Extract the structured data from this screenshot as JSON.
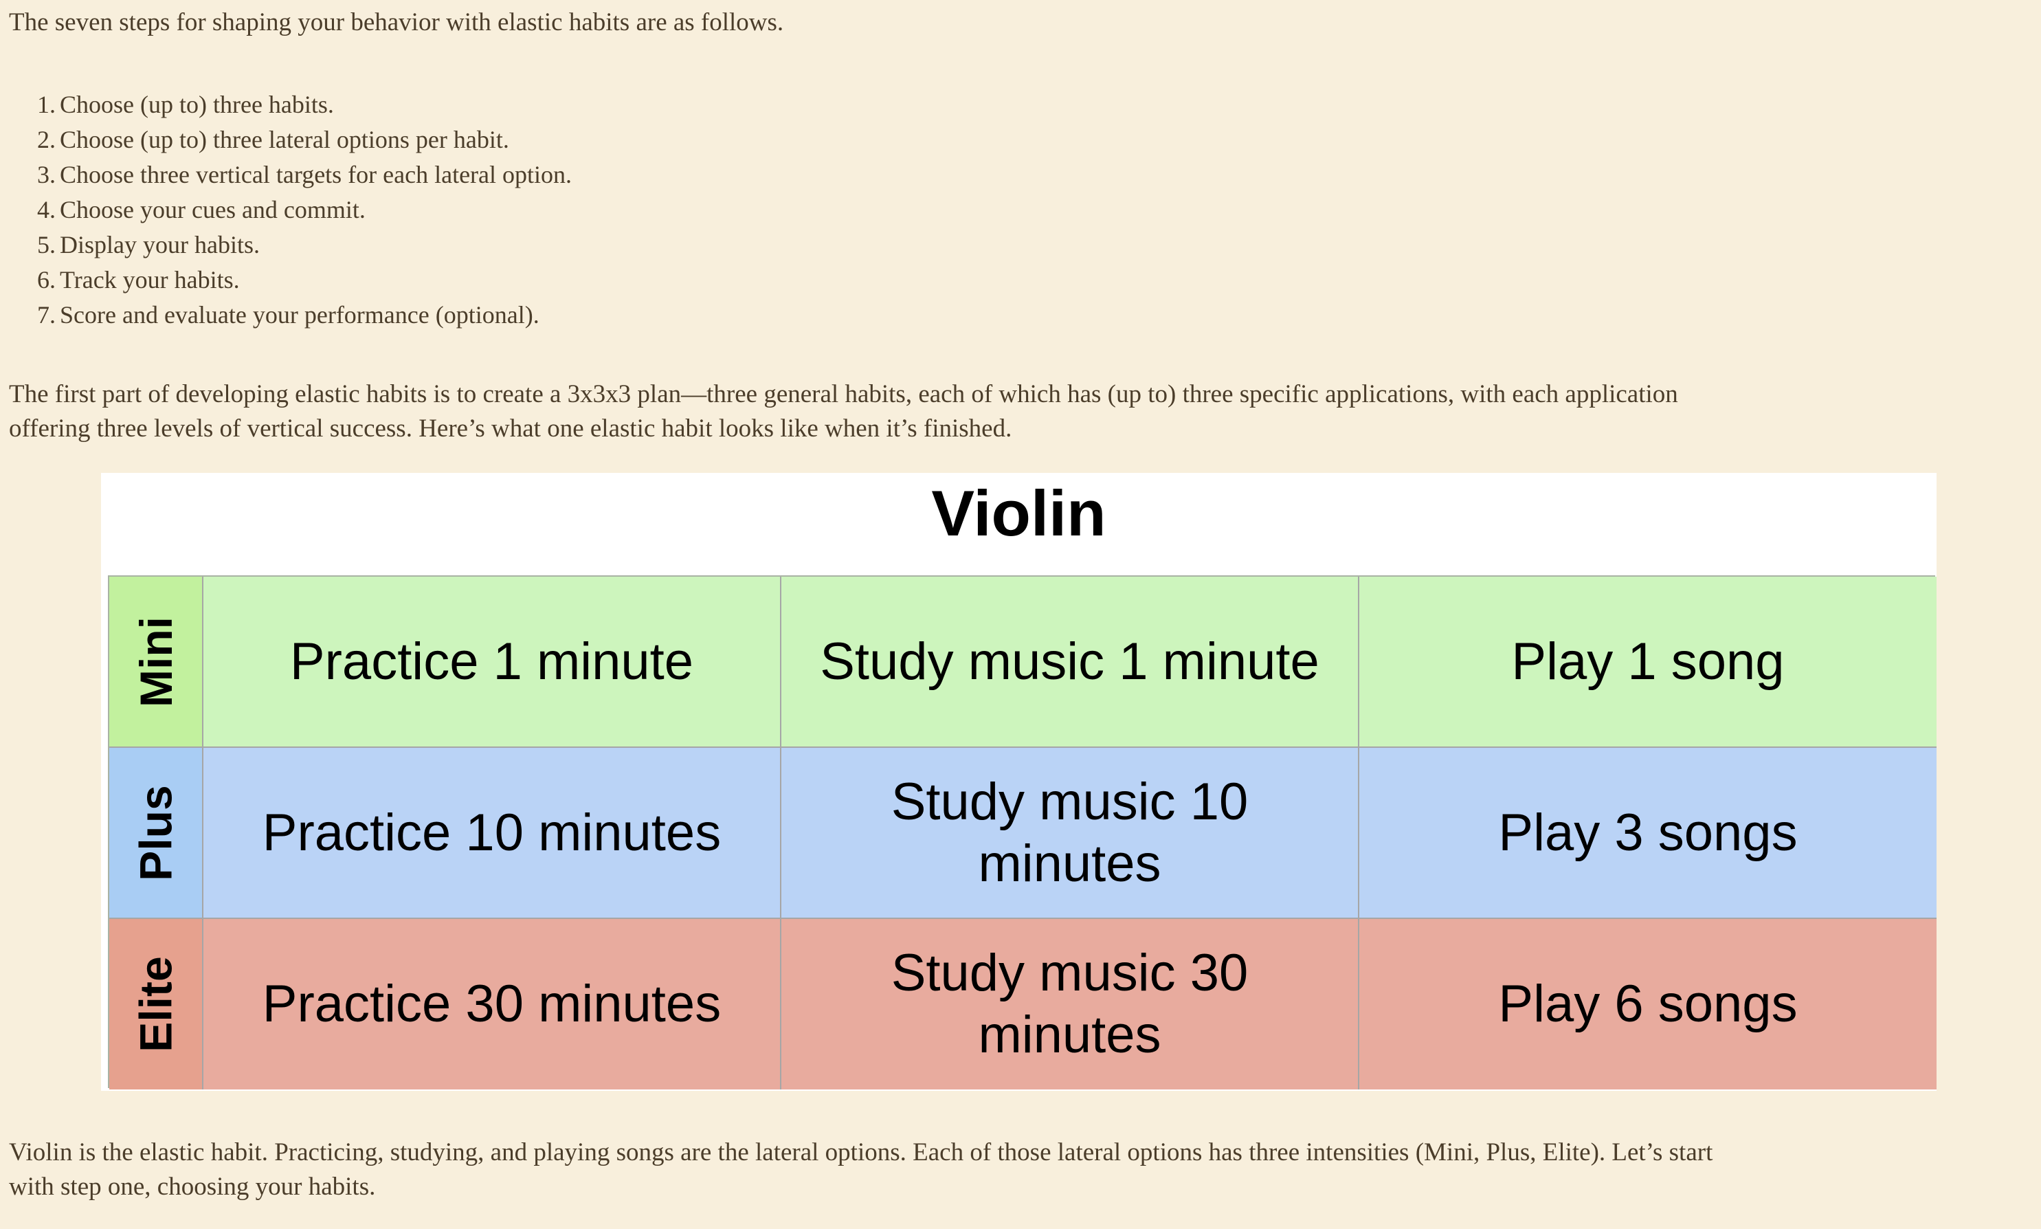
{
  "article": {
    "intro": "The seven steps for shaping your behavior with elastic habits are as follows.",
    "steps": [
      {
        "number": "1.",
        "text": "Choose (up to) three habits."
      },
      {
        "number": "2.",
        "text": "Choose (up to) three lateral options per habit."
      },
      {
        "number": "3.",
        "text": "Choose three vertical targets for each lateral option."
      },
      {
        "number": "4.",
        "text": "Choose your cues and commit."
      },
      {
        "number": "5.",
        "text": "Display your habits."
      },
      {
        "number": "6.",
        "text": "Track your habits."
      },
      {
        "number": "7.",
        "text": "Score and evaluate your performance (optional)."
      }
    ],
    "plan_paragraph": [
      "The first part of developing elastic habits is to create a 3x3x3 plan—three general habits, each of which has (up to) three specific applications, with each application",
      "offering three levels of vertical success. Here’s what one elastic habit looks like when it’s finished."
    ],
    "outro_paragraph": [
      "Violin is the elastic habit. Practicing, studying, and playing songs are the lateral options. Each of those lateral options has three intensities (Mini, Plus, Elite). Let’s start",
      "with step one, choosing your habits."
    ]
  },
  "habit_figure": {
    "title": "Violin",
    "levels": [
      {
        "label": "Mini",
        "color_label": "#c2f19e",
        "color_cells": "#cdf5bd",
        "cells": [
          "Practice 1 minute",
          "Study music 1 minute",
          "Play 1 song"
        ]
      },
      {
        "label": "Plus",
        "color_label": "#a9cdf4",
        "color_cells": "#bad3f6",
        "cells": [
          "Practice 10 minutes",
          "Study music 10 minutes",
          "Play 3 songs"
        ]
      },
      {
        "label": "Elite",
        "color_label": "#e6a18e",
        "color_cells": "#e8ab9e",
        "cells": [
          "Practice 30 minutes",
          "Study music 30 minutes",
          "Play 6 songs"
        ]
      }
    ]
  }
}
